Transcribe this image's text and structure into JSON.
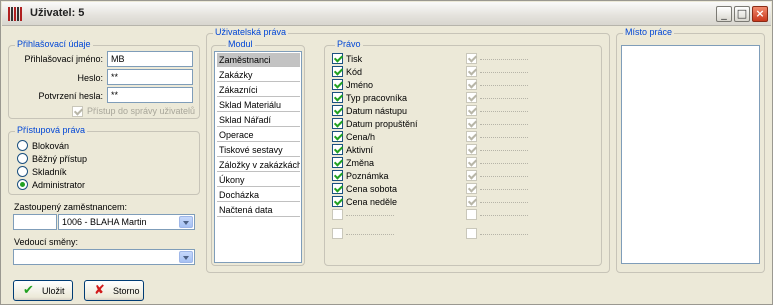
{
  "window": {
    "title": "Uživatel: 5"
  },
  "login": {
    "legend": "Přihlašovací údaje",
    "login_label": "Přihlašovací jméno:",
    "login_value": "MB",
    "password_label": "Heslo:",
    "password_value": "**",
    "confirm_label": "Potvrzení hesla:",
    "confirm_value": "**",
    "admin_access_label": "Přístup do správy uživatelů"
  },
  "access": {
    "legend": "Přístupová práva",
    "options": [
      "Blokován",
      "Běžný přístup",
      "Skladník",
      "Administrator"
    ],
    "selected": "Administrator"
  },
  "substitute": {
    "label": "Zastoupený zaměstnancem:",
    "code": "",
    "value": "1006 - BLAHA Martin"
  },
  "manager": {
    "label": "Vedoucí směny:",
    "value": ""
  },
  "rights": {
    "legend": "Uživatelská práva",
    "module_legend": "Modul",
    "modules": [
      "Zaměstnanci",
      "Zakázky",
      "Zákazníci",
      "Sklad Materiálu",
      "Sklad Nářadí",
      "Operace",
      "Tiskové sestavy",
      "Záložky v zakázkách",
      "Úkony",
      "Docházka",
      "Načtená data"
    ],
    "selected_module": "Zaměstnanci",
    "right_legend": "Právo",
    "rights": [
      "Tisk",
      "Kód",
      "Jméno",
      "Typ pracovníka",
      "Datum nástupu",
      "Datum propuštění",
      "Cena/h",
      "Aktivní",
      "Změna",
      "Poznámka",
      "Cena sobota",
      "Cena neděle"
    ]
  },
  "workplace": {
    "legend": "Místo práce"
  },
  "buttons": {
    "save": "Uložit",
    "cancel": "Storno"
  },
  "colors": {
    "legend": "#0046d5",
    "check": "#21a121",
    "cancel_icon": "#d11a1a"
  }
}
